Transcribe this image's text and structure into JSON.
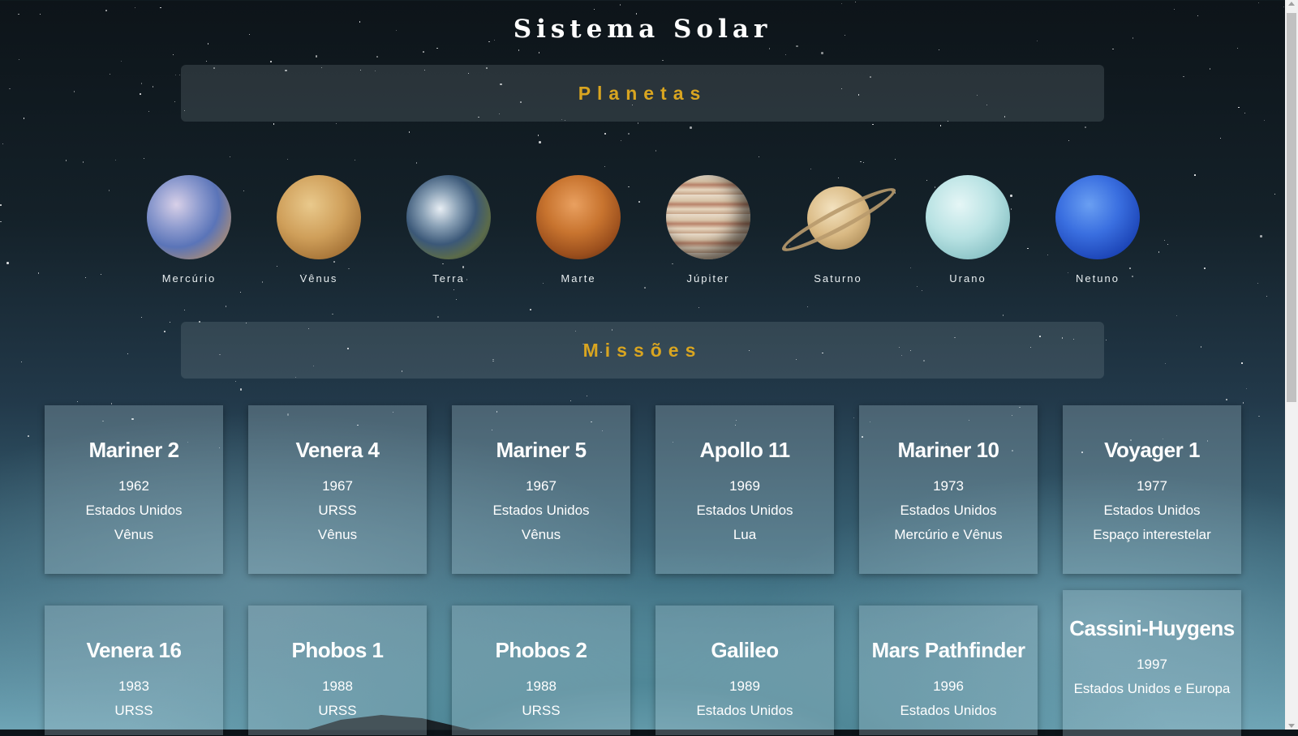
{
  "page": {
    "title": "Sistema Solar"
  },
  "sections": {
    "planets_heading": "Planetas",
    "missions_heading": "Missões"
  },
  "planets": [
    {
      "name": "Mercúrio",
      "icon": "mercury-icon"
    },
    {
      "name": "Vênus",
      "icon": "venus-icon"
    },
    {
      "name": "Terra",
      "icon": "earth-icon"
    },
    {
      "name": "Marte",
      "icon": "mars-icon"
    },
    {
      "name": "Júpiter",
      "icon": "jupiter-icon"
    },
    {
      "name": "Saturno",
      "icon": "saturn-icon"
    },
    {
      "name": "Urano",
      "icon": "uranus-icon"
    },
    {
      "name": "Netuno",
      "icon": "neptune-icon"
    }
  ],
  "missions": [
    {
      "name": "Mariner 2",
      "year": "1962",
      "country": "Estados Unidos",
      "target": "Vênus"
    },
    {
      "name": "Venera 4",
      "year": "1967",
      "country": "URSS",
      "target": "Vênus"
    },
    {
      "name": "Mariner 5",
      "year": "1967",
      "country": "Estados Unidos",
      "target": "Vênus"
    },
    {
      "name": "Apollo 11",
      "year": "1969",
      "country": "Estados Unidos",
      "target": "Lua"
    },
    {
      "name": "Mariner 10",
      "year": "1973",
      "country": "Estados Unidos",
      "target": "Mercúrio e Vênus"
    },
    {
      "name": "Voyager 1",
      "year": "1977",
      "country": "Estados Unidos",
      "target": "Espaço interestelar"
    },
    {
      "name": "Venera 16",
      "year": "1983",
      "country": "URSS",
      "target": ""
    },
    {
      "name": "Phobos 1",
      "year": "1988",
      "country": "URSS",
      "target": ""
    },
    {
      "name": "Phobos 2",
      "year": "1988",
      "country": "URSS",
      "target": ""
    },
    {
      "name": "Galileo",
      "year": "1989",
      "country": "Estados Unidos",
      "target": ""
    },
    {
      "name": "Mars Pathfinder",
      "year": "1996",
      "country": "Estados Unidos",
      "target": ""
    },
    {
      "name": "Cassini-Huygens",
      "year": "1997",
      "country": "Estados Unidos e Europa",
      "target": ""
    }
  ],
  "colors": {
    "heading_accent": "#d9a520",
    "text": "#ffffff"
  }
}
